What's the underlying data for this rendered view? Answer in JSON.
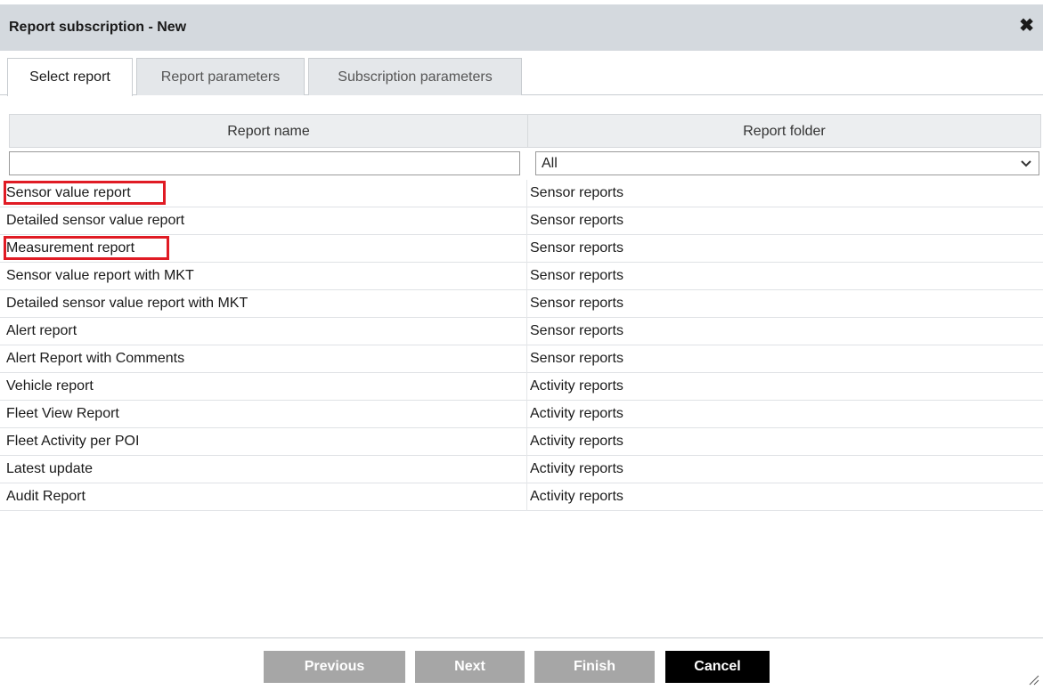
{
  "dialog": {
    "title": "Report subscription - New",
    "close_icon": "close-icon"
  },
  "tabs": [
    {
      "label": "Select report",
      "active": true
    },
    {
      "label": "Report parameters",
      "active": false
    },
    {
      "label": "Subscription parameters",
      "active": false
    }
  ],
  "grid": {
    "columns": [
      "Report name",
      "Report folder"
    ],
    "filter_name_value": "",
    "filter_folder_value": "All",
    "rows": [
      {
        "name": "Sensor value report",
        "folder": "Sensor reports",
        "highlighted": true
      },
      {
        "name": "Detailed sensor value report",
        "folder": "Sensor reports",
        "highlighted": false
      },
      {
        "name": "Measurement report",
        "folder": "Sensor reports",
        "highlighted": true
      },
      {
        "name": "Sensor value report with MKT",
        "folder": "Sensor reports",
        "highlighted": false
      },
      {
        "name": "Detailed sensor value report with MKT",
        "folder": "Sensor reports",
        "highlighted": false
      },
      {
        "name": "Alert report",
        "folder": "Sensor reports",
        "highlighted": false
      },
      {
        "name": "Alert Report with Comments",
        "folder": "Sensor reports",
        "highlighted": false
      },
      {
        "name": "Vehicle report",
        "folder": "Activity reports",
        "highlighted": false
      },
      {
        "name": "Fleet View Report",
        "folder": "Activity reports",
        "highlighted": false
      },
      {
        "name": "Fleet Activity per POI",
        "folder": "Activity reports",
        "highlighted": false
      },
      {
        "name": "Latest update",
        "folder": "Activity reports",
        "highlighted": false
      },
      {
        "name": "Audit Report",
        "folder": "Activity reports",
        "highlighted": false
      }
    ]
  },
  "footer": {
    "previous_label": "Previous",
    "next_label": "Next",
    "finish_label": "Finish",
    "cancel_label": "Cancel"
  },
  "colors": {
    "highlight": "#e01b24",
    "titlebar": "#d4d9de",
    "disabled_button": "#a6a6a6",
    "cancel_button": "#000000"
  }
}
